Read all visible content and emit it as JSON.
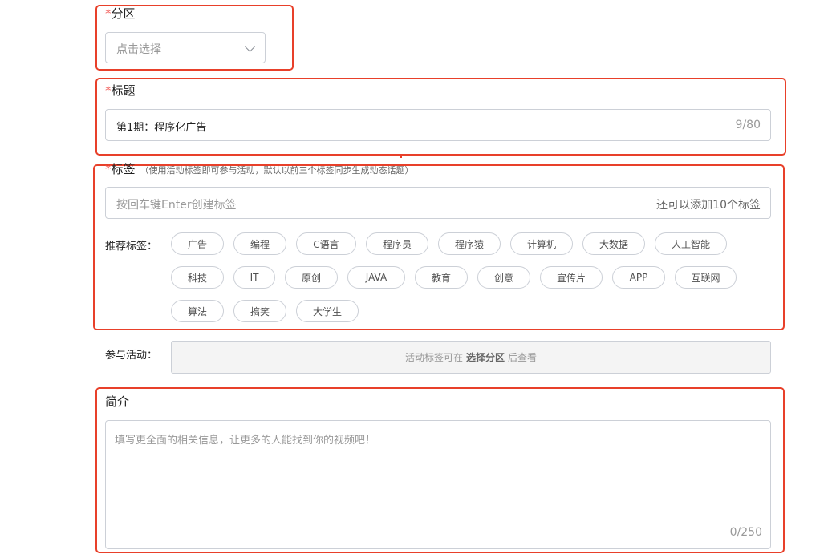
{
  "partition": {
    "star": "*",
    "label": "分区",
    "placeholder": "点击选择"
  },
  "title": {
    "star": "*",
    "label": "标题",
    "value": "第1期：程序化广告",
    "count": "9/80"
  },
  "tags": {
    "star": "*",
    "label": "标签",
    "hint": "（使用活动标签即可参与活动，默认以前三个标签同步生成动态话题）",
    "input_placeholder": "按回车键Enter创建标签",
    "remaining": "还可以添加10个标签",
    "recommend_label": "推荐标签：",
    "recommended": [
      "广告",
      "编程",
      "C语言",
      "程序员",
      "程序猿",
      "计算机",
      "大数据",
      "人工智能",
      "科技",
      "IT",
      "原创",
      "JAVA",
      "教育",
      "创意",
      "宣传片",
      "APP",
      "互联网",
      "算法",
      "搞笑",
      "大学生"
    ]
  },
  "activity": {
    "label": "参与活动：",
    "text_before": "活动标签可在",
    "text_bold": "选择分区",
    "text_after": "后查看"
  },
  "intro": {
    "label": "简介",
    "placeholder": "填写更全面的相关信息，让更多的人能找到你的视频吧！",
    "count": "0/250"
  },
  "colors": {
    "highlight": "#e8402a",
    "required_star": "#f25d59"
  }
}
